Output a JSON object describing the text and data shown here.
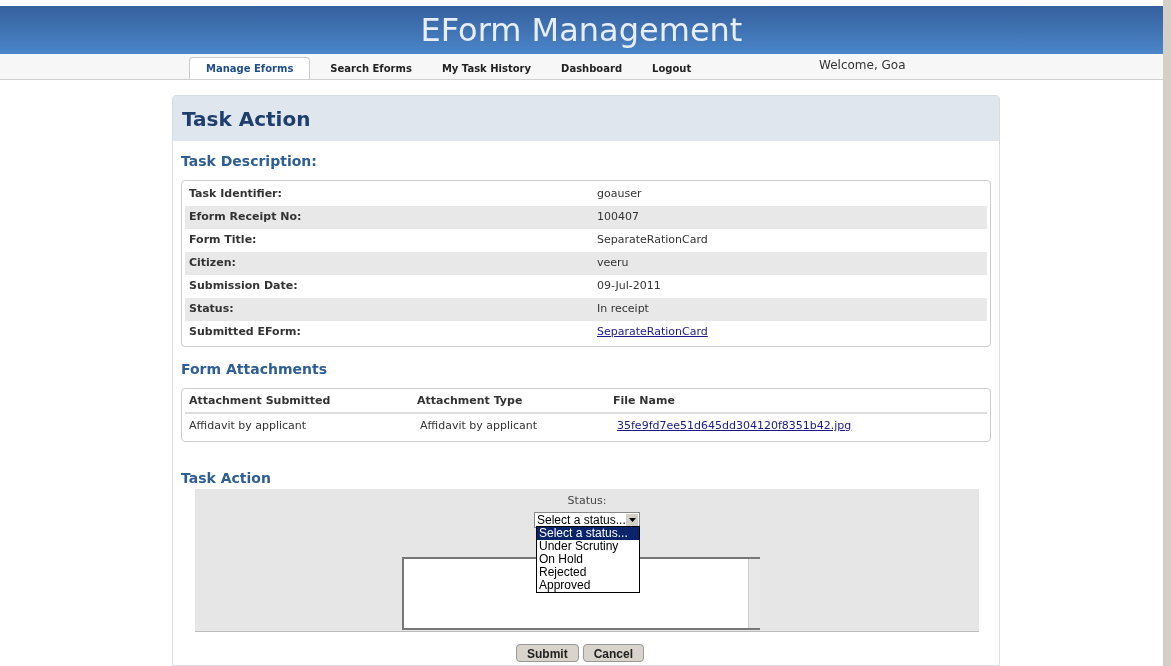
{
  "header": {
    "title": "EForm Management"
  },
  "nav": {
    "tabs": [
      {
        "label": "Manage Eforms",
        "selected": true
      },
      {
        "label": "Search Eforms",
        "selected": false
      },
      {
        "label": "My Task History",
        "selected": false
      },
      {
        "label": "Dashboard",
        "selected": false
      },
      {
        "label": "Logout",
        "selected": false
      }
    ],
    "welcome": "Welcome, Goa"
  },
  "panel": {
    "title": "Task Action"
  },
  "description": {
    "heading": "Task Description:",
    "rows": [
      {
        "label": "Task Identifier:",
        "value": "goauser",
        "kind": "text"
      },
      {
        "label": "Eform Receipt No:",
        "value": "100407",
        "kind": "text"
      },
      {
        "label": "Form Title:",
        "value": "SeparateRationCard",
        "kind": "text"
      },
      {
        "label": "Citizen:",
        "value": "veeru",
        "kind": "text"
      },
      {
        "label": "Submission Date:",
        "value": "09-Jul-2011",
        "kind": "text"
      },
      {
        "label": "Status:",
        "value": "In receipt",
        "kind": "text"
      },
      {
        "label": "Submitted EForm:",
        "value": "SeparateRationCard",
        "kind": "link"
      }
    ]
  },
  "attachments": {
    "heading": "Form Attachments",
    "columns": [
      "Attachment Submitted",
      "Attachment Type",
      "File Name"
    ],
    "rows": [
      {
        "submitted": "Affidavit by applicant",
        "type": "Affidavit by applicant",
        "file": "35fe9fd7ee51d645dd304120f8351b42.jpg"
      }
    ]
  },
  "task_action": {
    "heading": "Task Action",
    "status_label": "Status:",
    "select": {
      "value": "Select a status...",
      "expanded": true,
      "options": [
        {
          "label": "Select a status...",
          "selected": true
        },
        {
          "label": "Under Scrutiny",
          "selected": false
        },
        {
          "label": "On Hold",
          "selected": false
        },
        {
          "label": "Rejected",
          "selected": false
        },
        {
          "label": "Approved",
          "selected": false
        }
      ]
    }
  },
  "buttons": [
    "Submit",
    "Cancel"
  ]
}
